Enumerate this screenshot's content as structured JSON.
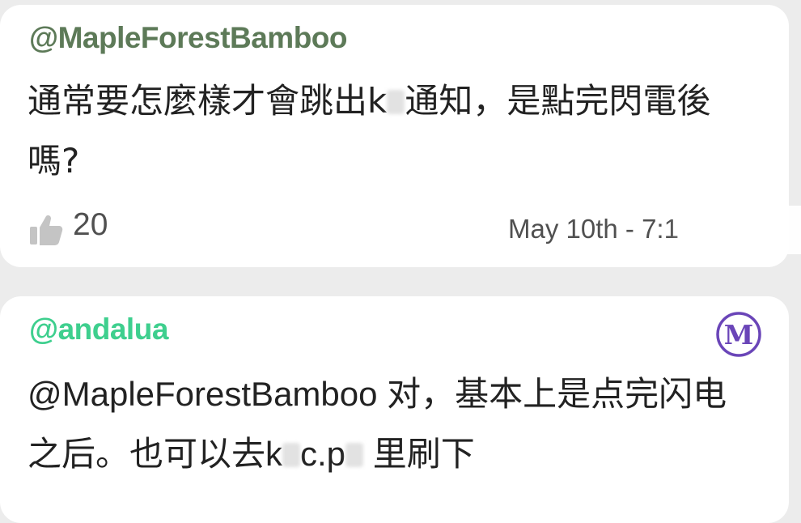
{
  "comments": [
    {
      "username": "@MapleForestBamboo",
      "username_color": "#5d7a58",
      "text_before": "通常要怎麼樣才會跳出k",
      "text_after": "通知，是點完閃電後嗎?",
      "likes": "20",
      "timestamp": "May 10th - 7:1",
      "like_icon": "thumbs-up-icon"
    },
    {
      "username": "@andalua",
      "username_color": "#3ecf8e",
      "text_a": "@MapleForestBamboo 对，基本上是点完闪电之后。也可以去k",
      "text_b": "c.p",
      "text_c": " 里刷下",
      "badge": "M",
      "badge_icon": "moderator-badge-icon",
      "badge_color": "#6a45b8"
    }
  ]
}
